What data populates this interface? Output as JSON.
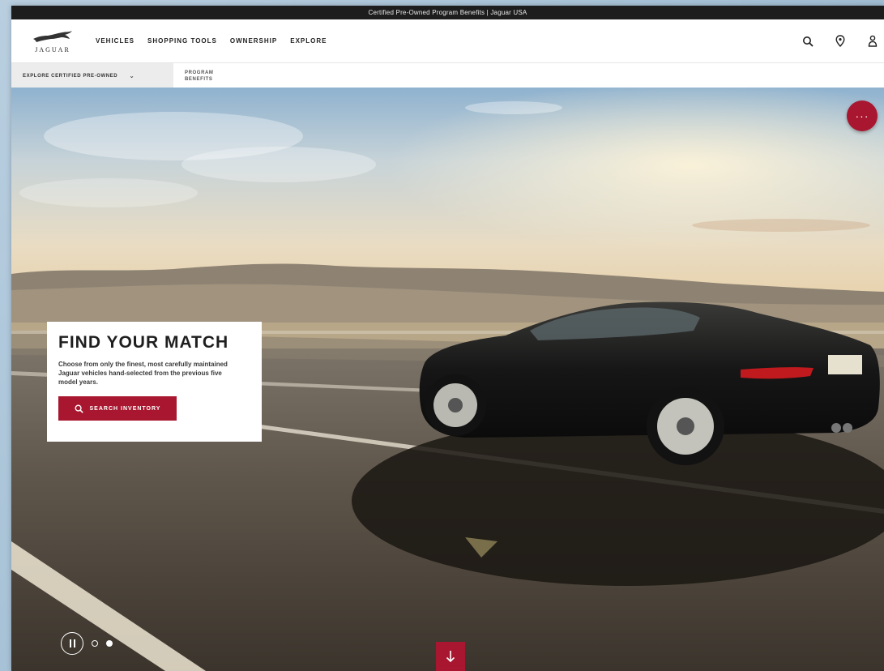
{
  "window": {
    "title": "Certified Pre-Owned Program Benefits | Jaguar USA"
  },
  "header": {
    "logo_text": "JAGUAR",
    "nav": [
      "VEHICLES",
      "SHOPPING TOOLS",
      "OWNERSHIP",
      "EXPLORE"
    ],
    "icons": [
      "search-icon",
      "location-pin-icon",
      "user-icon"
    ]
  },
  "subnav": {
    "dropdown_label": "EXPLORE CERTIFIED PRE-OWNED",
    "link_line1": "PROGRAM",
    "link_line2": "BENEFITS"
  },
  "hero": {
    "headline": "FIND YOUR MATCH",
    "body": "Choose from only the finest, most carefully maintained Jaguar vehicles hand-selected from the previous five model years.",
    "cta_label": "SEARCH INVENTORY",
    "fab_label": "···",
    "carousel_active": 2,
    "carousel_total": 2
  },
  "colors": {
    "accent": "#a8172f",
    "topbar": "#1d1d1d",
    "subnav_bg": "#ececec"
  }
}
